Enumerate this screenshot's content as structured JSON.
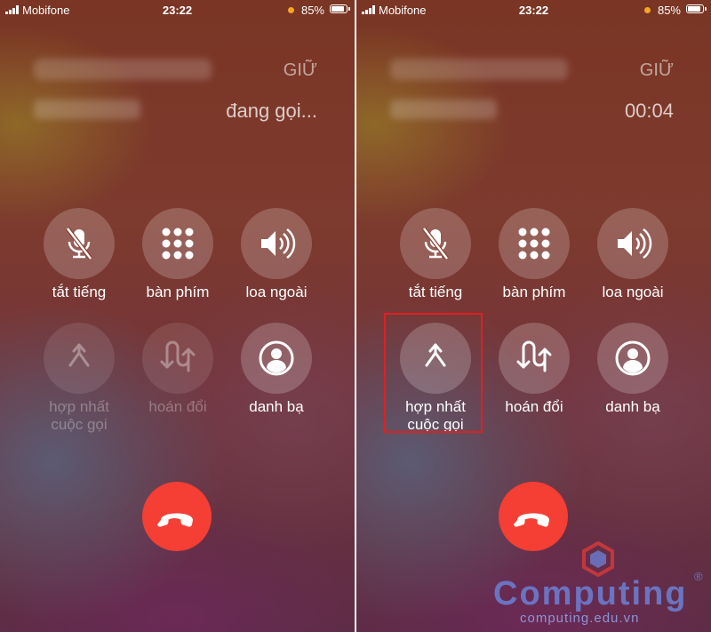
{
  "status_bar": {
    "carrier": "Mobifone",
    "time": "23:22",
    "battery": "85%",
    "battery_level": 0.85
  },
  "left": {
    "hold_label": "GIỮ",
    "call_status": "đang gọi...",
    "buttons": [
      {
        "label": "tắt tiếng",
        "icon": "mute-icon"
      },
      {
        "label": "bàn phím",
        "icon": "keypad-icon"
      },
      {
        "label": "loa ngoài",
        "icon": "speaker-icon"
      },
      {
        "label_line1": "hợp nhất",
        "label_line2": "cuộc gọi",
        "icon": "merge-icon",
        "enabled": false
      },
      {
        "label": "hoán đổi",
        "icon": "swap-icon",
        "enabled": false
      },
      {
        "label": "danh bạ",
        "icon": "contact-icon"
      }
    ]
  },
  "right": {
    "hold_label": "GIỮ",
    "call_status": "00:04",
    "buttons": [
      {
        "label": "tắt tiếng",
        "icon": "mute-icon"
      },
      {
        "label": "bàn phím",
        "icon": "keypad-icon"
      },
      {
        "label": "loa ngoài",
        "icon": "speaker-icon"
      },
      {
        "label_line1": "hợp nhất",
        "label_line2": "cuộc gọi",
        "icon": "merge-icon",
        "enabled": true,
        "highlighted": true
      },
      {
        "label": "hoán đổi",
        "icon": "swap-icon",
        "enabled": true
      },
      {
        "label": "danh bạ",
        "icon": "contact-icon"
      }
    ]
  },
  "end_call_color": "#f53e34",
  "highlight_color": "#e02020",
  "watermark": {
    "brand": "Computing",
    "reg": "®",
    "url": "computing.edu.vn",
    "color": "#6b78c8"
  }
}
